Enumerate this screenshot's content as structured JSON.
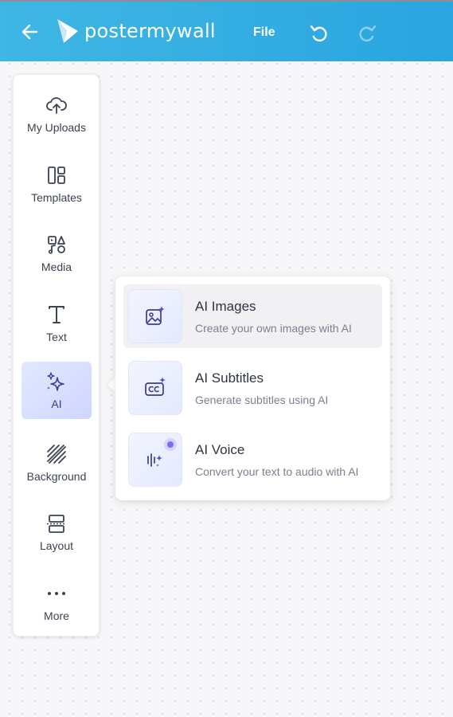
{
  "app": {
    "logo_text": "postermywall",
    "file_label": "File"
  },
  "colors": {
    "header_bg": "#2aa5e0",
    "active_item_bg": "#d9dfff",
    "icon_accent": "#3a3f8f",
    "sparkle_accent": "#4a48d9"
  },
  "sidebar": {
    "items": [
      {
        "label": "My Uploads",
        "icon": "cloud-upload-icon"
      },
      {
        "label": "Templates",
        "icon": "templates-icon"
      },
      {
        "label": "Media",
        "icon": "media-icon"
      },
      {
        "label": "Text",
        "icon": "text-icon"
      },
      {
        "label": "AI",
        "icon": "ai-sparkle-icon",
        "active": true
      },
      {
        "label": "Background",
        "icon": "background-icon"
      },
      {
        "label": "Layout",
        "icon": "layout-icon"
      },
      {
        "label": "More",
        "icon": "more-icon"
      }
    ]
  },
  "ai_menu": {
    "items": [
      {
        "title": "AI Images",
        "desc": "Create your own images with AI",
        "icon": "ai-image-icon"
      },
      {
        "title": "AI Subtitles",
        "desc": "Generate subtitles using AI",
        "icon": "ai-subtitles-icon"
      },
      {
        "title": "AI Voice",
        "desc": "Convert your text to audio with AI",
        "icon": "ai-voice-icon"
      }
    ]
  }
}
